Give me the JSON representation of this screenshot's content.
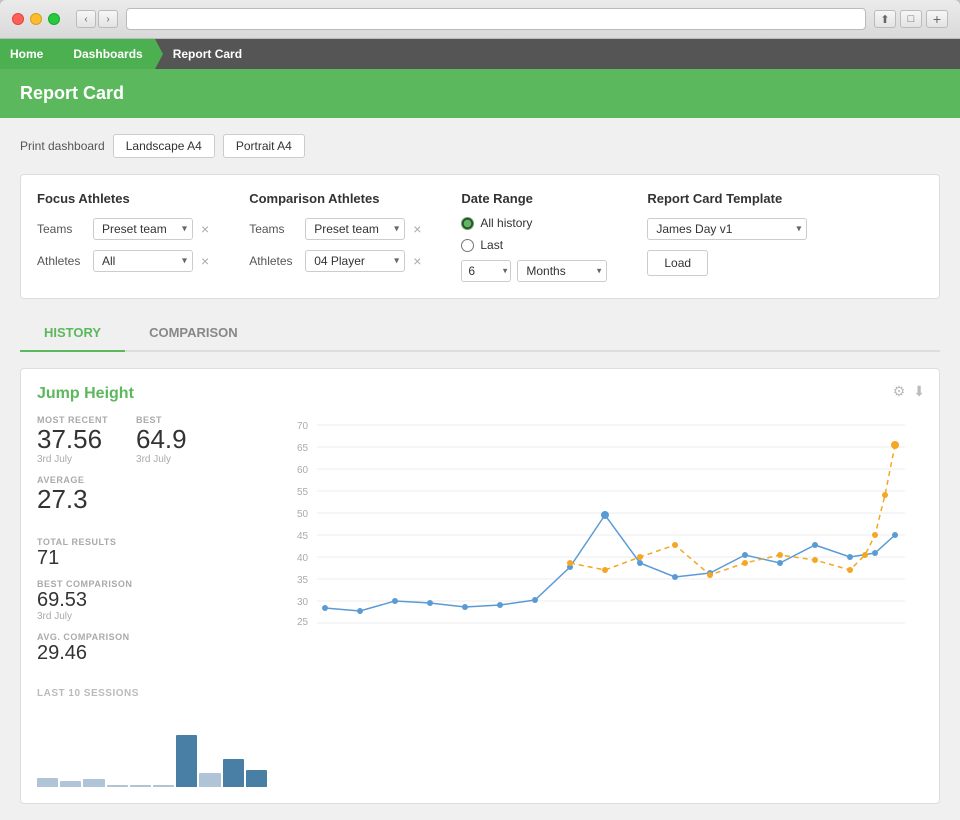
{
  "browser": {
    "url": ""
  },
  "nav": {
    "home": "Home",
    "dashboards": "Dashboards",
    "report_card": "Report Card"
  },
  "page": {
    "title": "Report Card"
  },
  "print_bar": {
    "label": "Print dashboard",
    "landscape_btn": "Landscape A4",
    "portrait_btn": "Portrait A4"
  },
  "focus_athletes": {
    "title": "Focus Athletes",
    "teams_label": "Teams",
    "teams_value": "Preset team",
    "athletes_label": "Athletes",
    "athletes_value": "All"
  },
  "comparison_athletes": {
    "title": "Comparison Athletes",
    "teams_label": "Teams",
    "teams_value": "Preset team",
    "athletes_label": "Athletes",
    "athletes_value": "04 Player"
  },
  "date_range": {
    "title": "Date Range",
    "all_history_label": "All history",
    "last_label": "Last",
    "number_value": "6",
    "period_value": "Months"
  },
  "report_card_template": {
    "title": "Report Card Template",
    "template_value": "James Day v1",
    "load_btn": "Load"
  },
  "tabs": {
    "history": "HISTORY",
    "comparison": "COMPARISON"
  },
  "chart": {
    "title": "Jump Height",
    "most_recent_label": "MOST RECENT",
    "most_recent_value": "37.56",
    "most_recent_date": "3rd July",
    "best_label": "BEST",
    "best_value": "64.9",
    "best_date": "3rd July",
    "average_label": "AVERAGE",
    "average_value": "27.3",
    "total_results_label": "TOTAL RESULTS",
    "total_results_value": "71",
    "best_comparison_label": "BEST COMPARISON",
    "best_comparison_value": "69.53",
    "best_comparison_date": "3rd July",
    "avg_comparison_label": "AVG. COMPARISON",
    "avg_comparison_value": "29.46",
    "last_sessions_label": "LAST 10 SESSIONS",
    "y_axis": [
      "70",
      "65",
      "60",
      "55",
      "50",
      "45",
      "40",
      "35",
      "30",
      "25"
    ],
    "bars": [
      2,
      1,
      2,
      0,
      0,
      0,
      5,
      1,
      3,
      2
    ],
    "bar_heights_pct": [
      12,
      8,
      10,
      0,
      0,
      0,
      60,
      15,
      30,
      20
    ]
  }
}
